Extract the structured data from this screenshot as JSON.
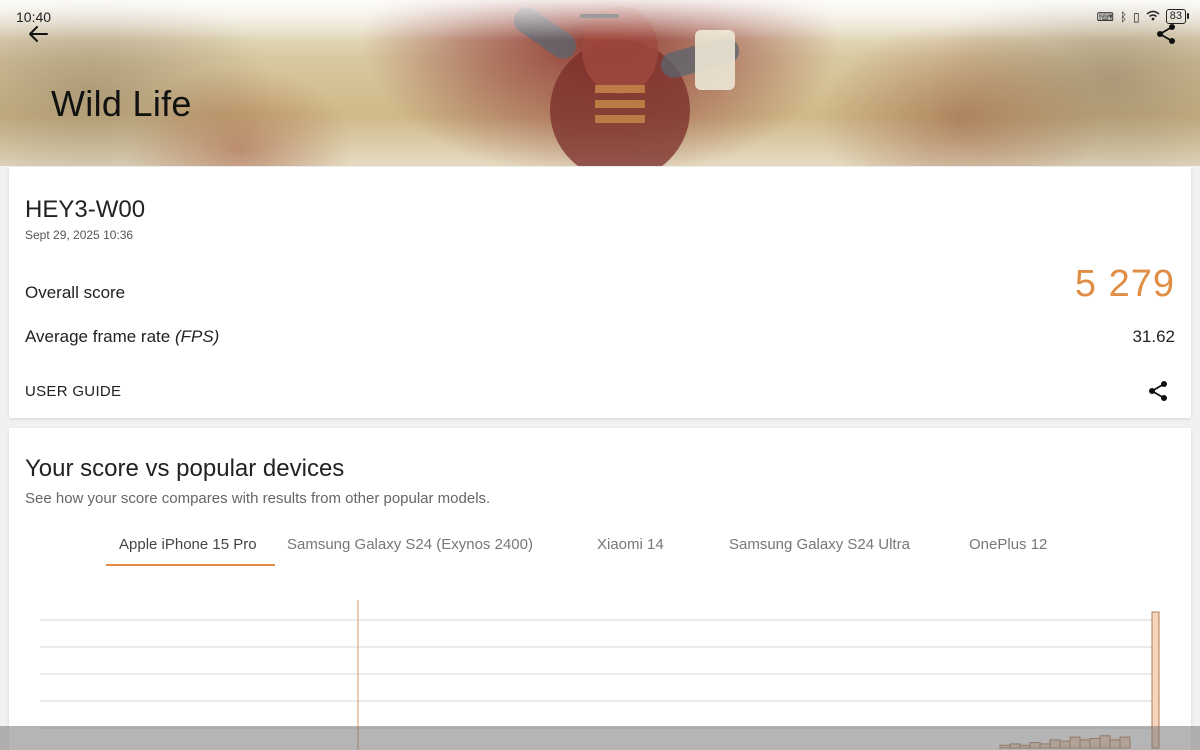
{
  "status_bar": {
    "time": "10:40",
    "battery": "83",
    "icons": [
      "keyboard-icon",
      "bluetooth-icon",
      "vibrate-icon",
      "wifi-icon",
      "battery-icon"
    ]
  },
  "header": {
    "title": "Wild Life",
    "back_icon": "arrow-left-icon",
    "share_icon": "share-icon"
  },
  "result": {
    "device": "HEY3-W00",
    "date": "Sept 29, 2025 10:36",
    "overall_label": "Overall score",
    "overall_value": "5 279",
    "fps_label": "Average frame rate",
    "fps_unit": "(FPS)",
    "fps_value": "31.62",
    "user_guide": "USER GUIDE"
  },
  "comparison": {
    "title": "Your score vs popular devices",
    "subtitle": "See how your score compares with results from other popular models.",
    "tabs": [
      {
        "label": "Apple iPhone 15 Pro",
        "active": true
      },
      {
        "label": "Samsung Galaxy S24 (Exynos 2400)",
        "active": false
      },
      {
        "label": "Xiaomi 14",
        "active": false
      },
      {
        "label": "Samsung Galaxy S24 Ultra",
        "active": false
      },
      {
        "label": "OnePlus 12",
        "active": false
      }
    ]
  },
  "colors": {
    "accent": "#e08e45",
    "bar_fill": "#f3d5bd",
    "bar_stroke": "#b07a55",
    "marker": "#e0a77a"
  },
  "chart_data": {
    "type": "bar",
    "your_score_marker": "left",
    "distribution_relative": [
      0.02,
      0.03,
      0.02,
      0.04,
      0.03,
      0.06,
      0.05,
      0.08,
      0.06,
      0.07,
      0.09,
      0.06,
      0.08,
      1.0
    ],
    "grid": true
  }
}
